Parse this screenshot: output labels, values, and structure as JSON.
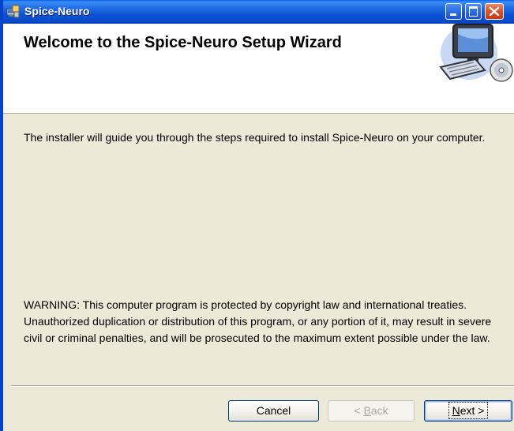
{
  "window": {
    "title": "Spice-Neuro",
    "title_icon": "installer-app-icon",
    "controls": {
      "minimize_icon": "minimize-icon",
      "maximize_icon": "maximize-icon",
      "close_icon": "close-icon"
    }
  },
  "banner": {
    "title": "Welcome to the Spice-Neuro Setup Wizard",
    "graphic": "computer-with-cd-icon"
  },
  "body": {
    "intro": "The installer will guide you through the steps required to install Spice-Neuro on your computer.",
    "warning": "WARNING: This computer program is protected by copyright law and international treaties. Unauthorized duplication or distribution of this program, or any portion of it, may result in severe civil or criminal penalties, and will be prosecuted to the maximum extent possible under the law."
  },
  "buttons": {
    "cancel": {
      "label": "Cancel",
      "enabled": true
    },
    "back": {
      "label": "< Back",
      "accelerator": "B",
      "enabled": false
    },
    "next": {
      "label": "Next >",
      "accelerator": "N",
      "enabled": true,
      "default": true
    }
  },
  "colors": {
    "titlebar": "#0a4ccc",
    "dialog_background": "#ece9d8",
    "close_button": "#d8532c"
  }
}
